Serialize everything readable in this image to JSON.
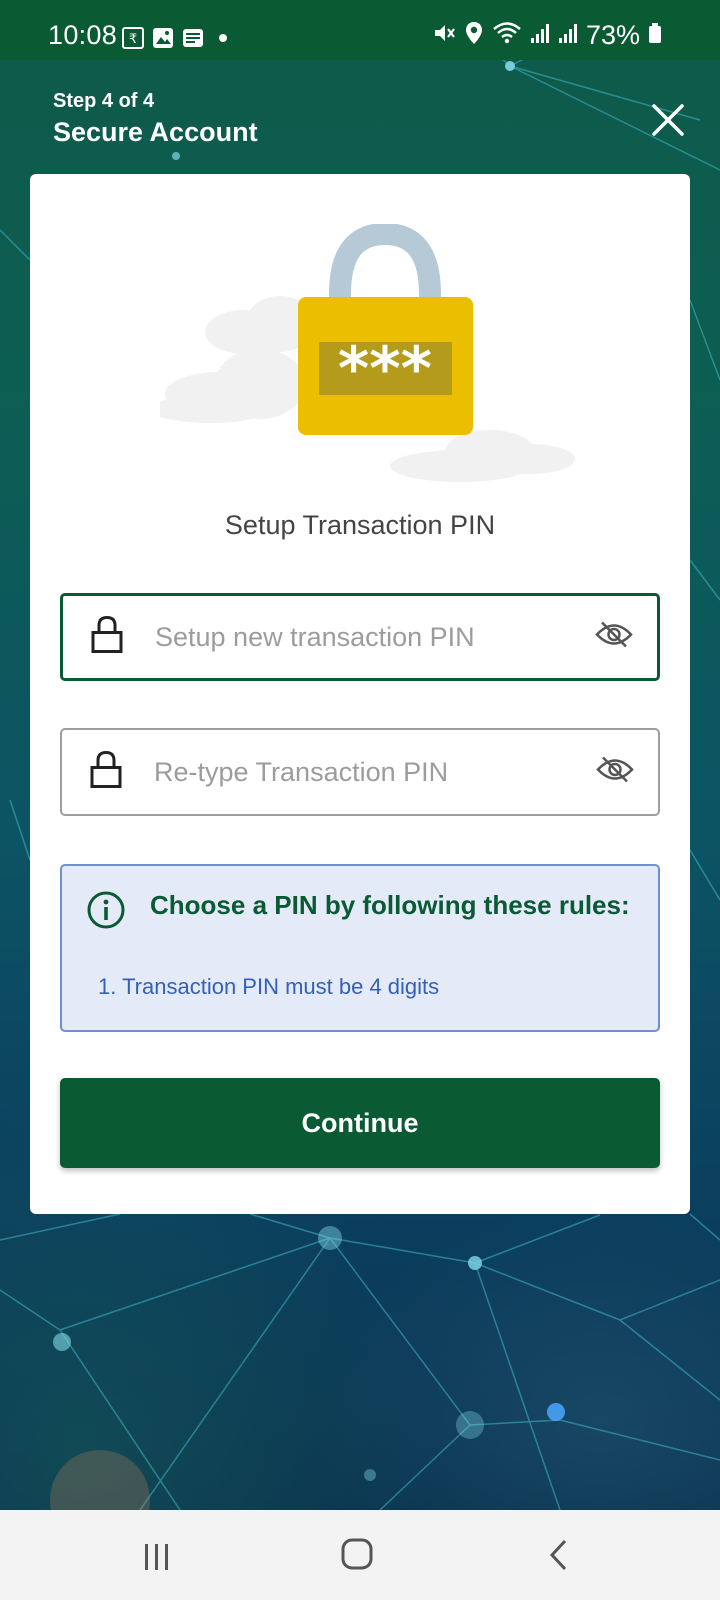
{
  "status_bar": {
    "time": "10:08",
    "battery": "73%",
    "left_icons": [
      "rupee-icon",
      "image-icon",
      "news-icon",
      "dot-icon"
    ],
    "right_icons": [
      "mute-icon",
      "location-icon",
      "wifi-icon",
      "signal-icon",
      "signal-icon",
      "battery-icon"
    ]
  },
  "header": {
    "step": "Step 4 of 4",
    "title": "Secure Account",
    "close_icon": "close-icon"
  },
  "illustration": {
    "name": "padlock-illustration",
    "pin_mask": "***"
  },
  "card": {
    "title": "Setup Transaction PIN"
  },
  "fields": {
    "new_pin": {
      "placeholder": "Setup new transaction PIN",
      "value": ""
    },
    "retype_pin": {
      "placeholder": "Re-type Transaction PIN",
      "value": ""
    }
  },
  "rules": {
    "title": "Choose a PIN by following these rules:",
    "items": [
      "1. Transaction PIN must be 4 digits"
    ]
  },
  "continue_label": "Continue",
  "colors": {
    "primary_green": "#0a5a34",
    "rules_bg": "#e5eaf8",
    "rules_border": "#6f8fd0",
    "rules_text": "#3460b8",
    "lock_yellow": "#ecbe00"
  },
  "nav": {
    "recents_icon": "recents-icon",
    "home_icon": "home-icon",
    "back_icon": "back-icon"
  }
}
